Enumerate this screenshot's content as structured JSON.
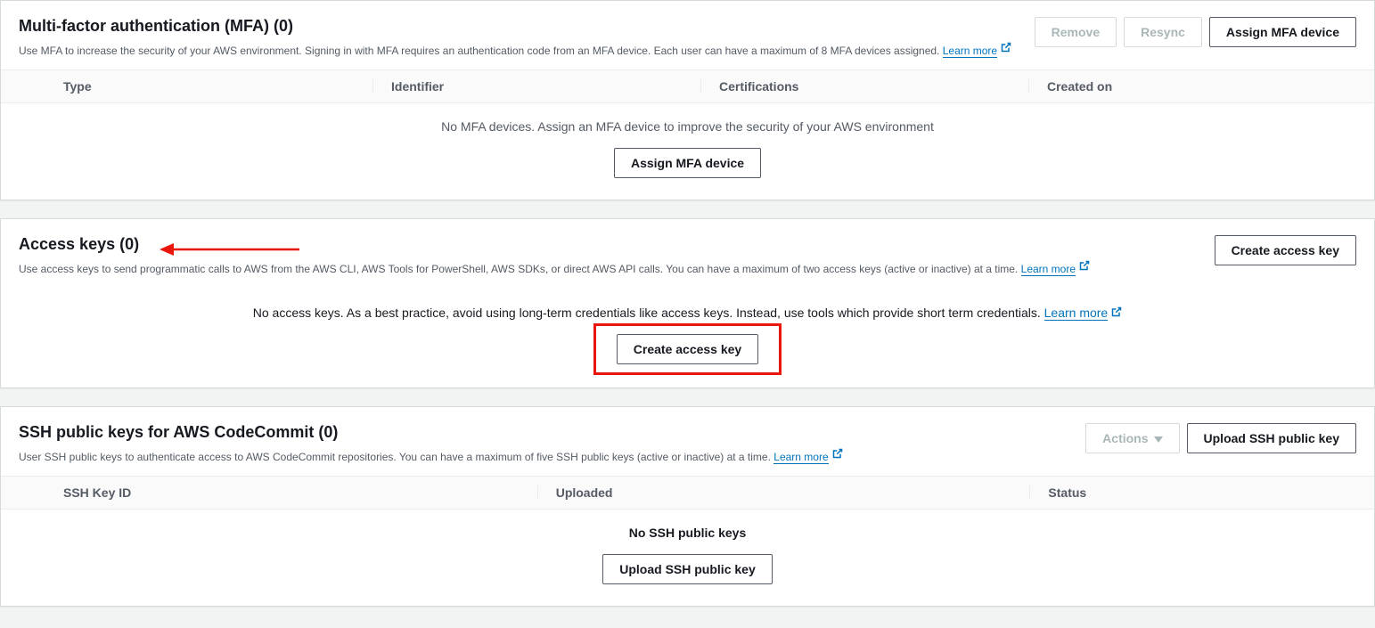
{
  "mfa": {
    "title": "Multi-factor authentication (MFA) (0)",
    "desc": "Use MFA to increase the security of your AWS environment. Signing in with MFA requires an authentication code from an MFA device. Each user can have a maximum of 8 MFA devices assigned. ",
    "learn_more": "Learn more",
    "remove": "Remove",
    "resync": "Resync",
    "assign": "Assign MFA device",
    "cols": {
      "type": "Type",
      "identifier": "Identifier",
      "certifications": "Certifications",
      "created": "Created on"
    },
    "empty_msg": "No MFA devices. Assign an MFA device to improve the security of your AWS environment",
    "empty_btn": "Assign MFA device"
  },
  "access": {
    "title": "Access keys (0)",
    "desc": "Use access keys to send programmatic calls to AWS from the AWS CLI, AWS Tools for PowerShell, AWS SDKs, or direct AWS API calls. You can have a maximum of two access keys (active or inactive) at a time. ",
    "learn_more": "Learn more",
    "create": "Create access key",
    "empty_msg": "No access keys. As a best practice, avoid using long-term credentials like access keys. Instead, use tools which provide short term credentials. ",
    "empty_learn": "Learn more",
    "empty_btn": "Create access key"
  },
  "ssh": {
    "title": "SSH public keys for AWS CodeCommit (0)",
    "desc": "User SSH public keys to authenticate access to AWS CodeCommit repositories. You can have a maximum of five SSH public keys (active or inactive) at a time. ",
    "learn_more": "Learn more",
    "actions": "Actions",
    "upload": "Upload SSH public key",
    "cols": {
      "id": "SSH Key ID",
      "uploaded": "Uploaded",
      "status": "Status"
    },
    "empty_msg": "No SSH public keys",
    "empty_btn": "Upload SSH public key"
  }
}
